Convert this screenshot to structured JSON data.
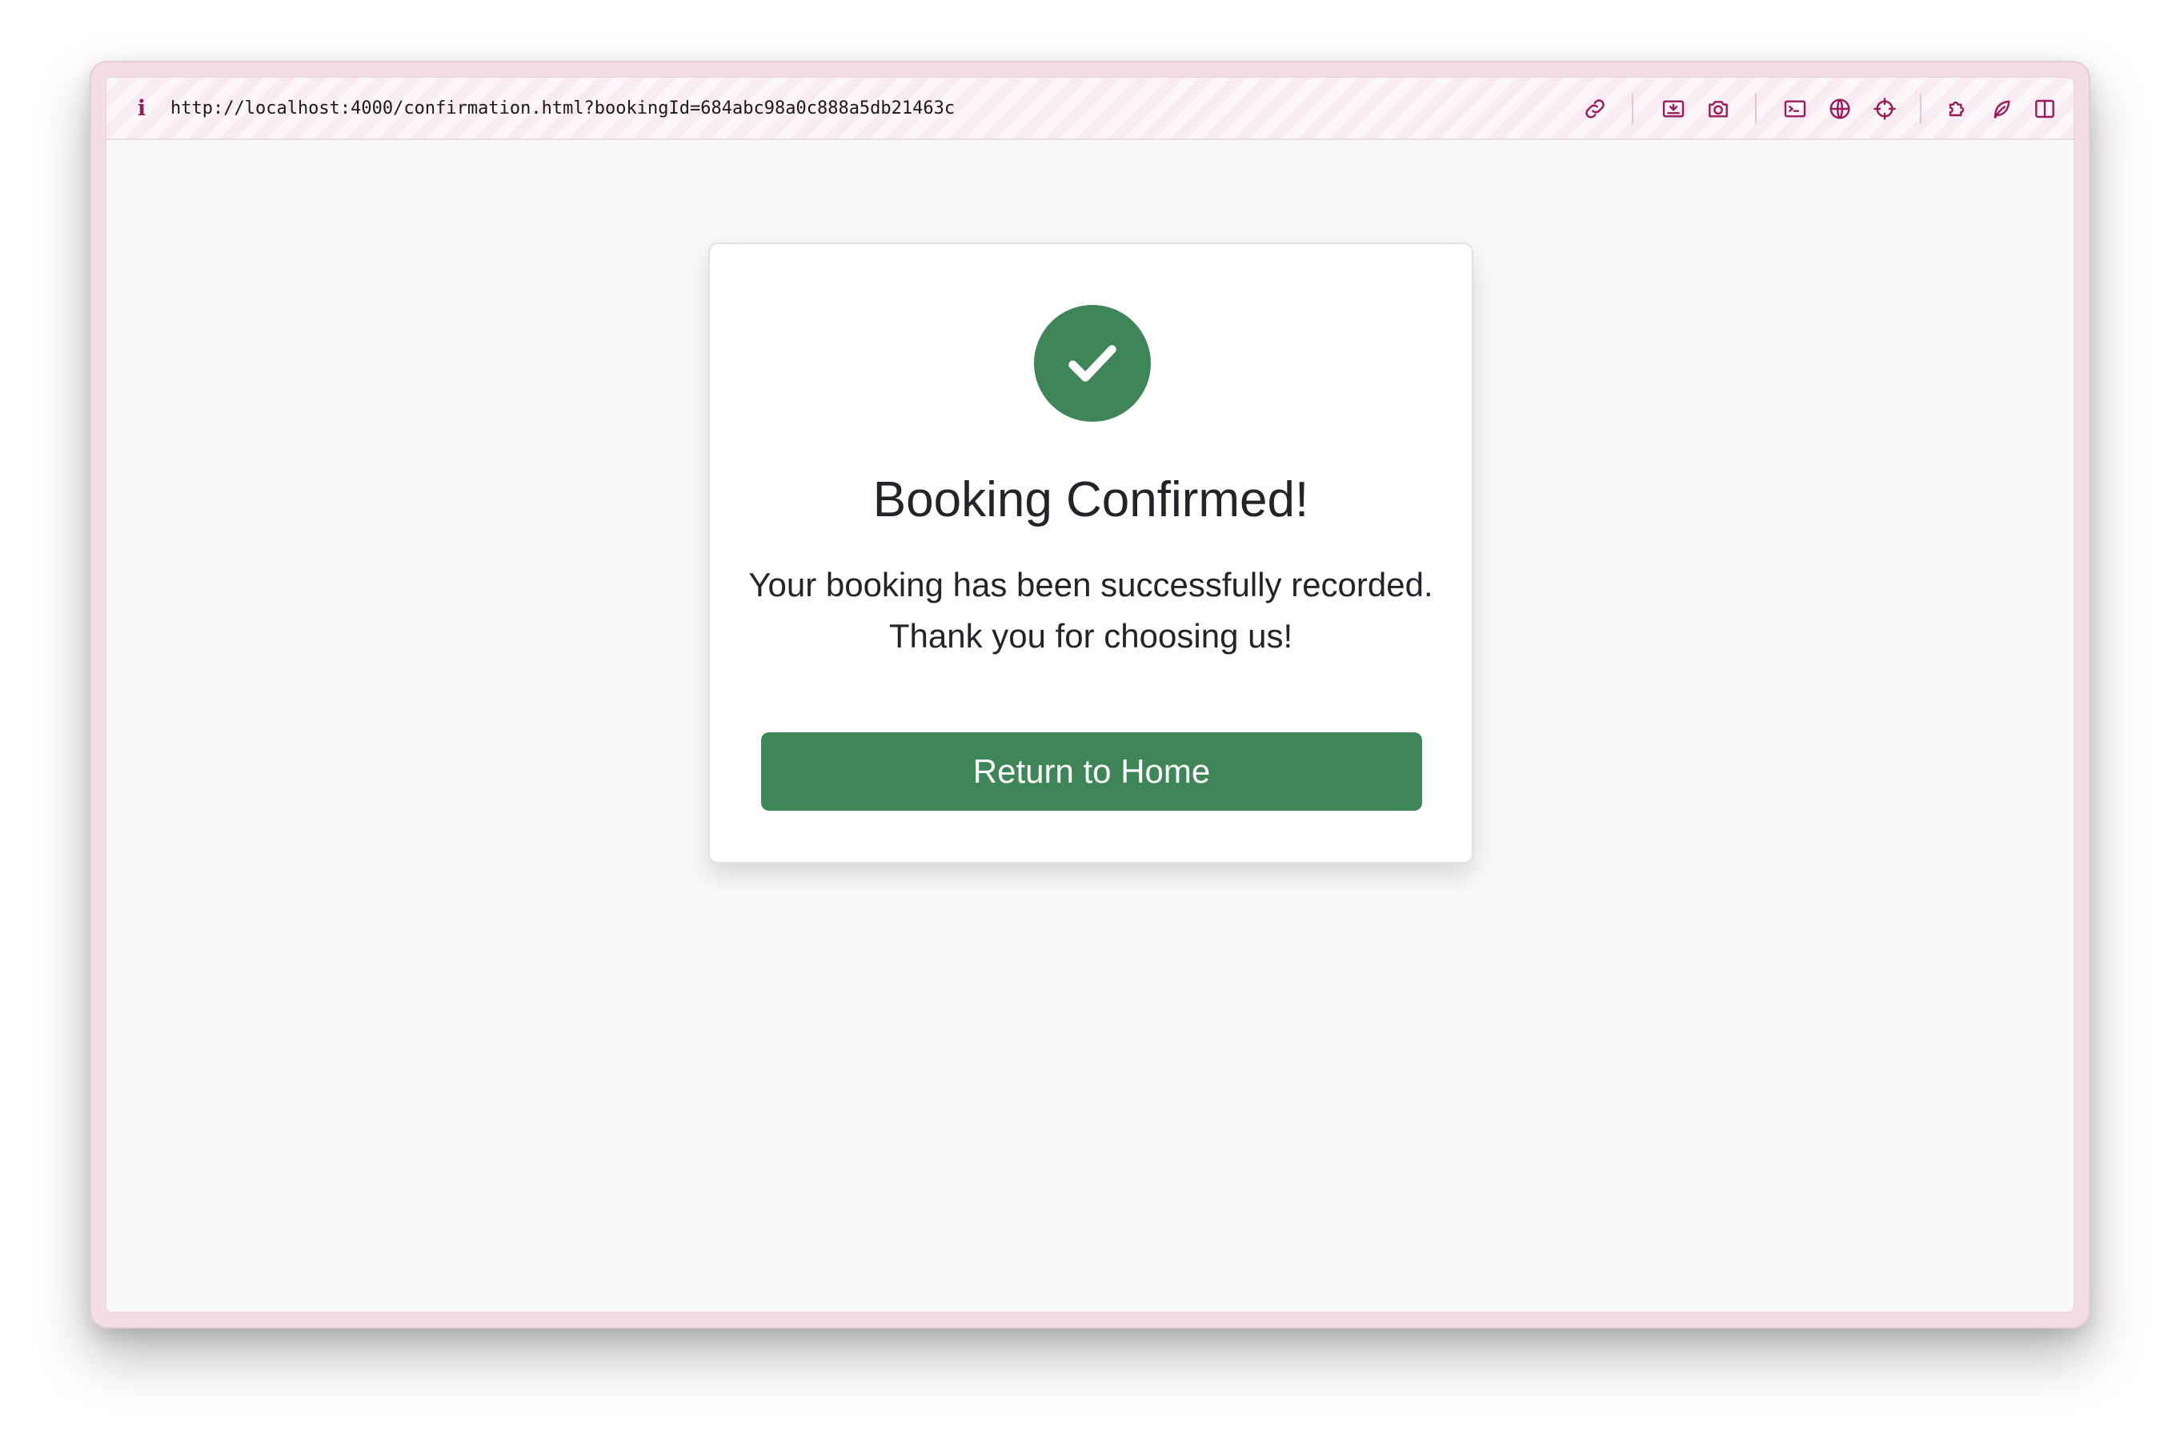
{
  "browser": {
    "url": "http://localhost:4000/confirmation.html?bookingId=684abc98a0c888a5db21463c",
    "info_icon": "i",
    "accent_color": "#9b1a5a",
    "toolbar_icons": [
      "link-icon",
      "screenshot-region-icon",
      "camera-icon",
      "terminal-icon",
      "globe-icon",
      "crosshair-icon",
      "extensions-icon",
      "leaf-icon",
      "sidebar-icon"
    ]
  },
  "confirmation": {
    "title": "Booking Confirmed!",
    "message_line1": "Your booking has been successfully recorded.",
    "message_line2": "Thank you for choosing us!",
    "button_label": "Return to Home",
    "icon": "check-icon",
    "success_color": "#3e8558"
  }
}
